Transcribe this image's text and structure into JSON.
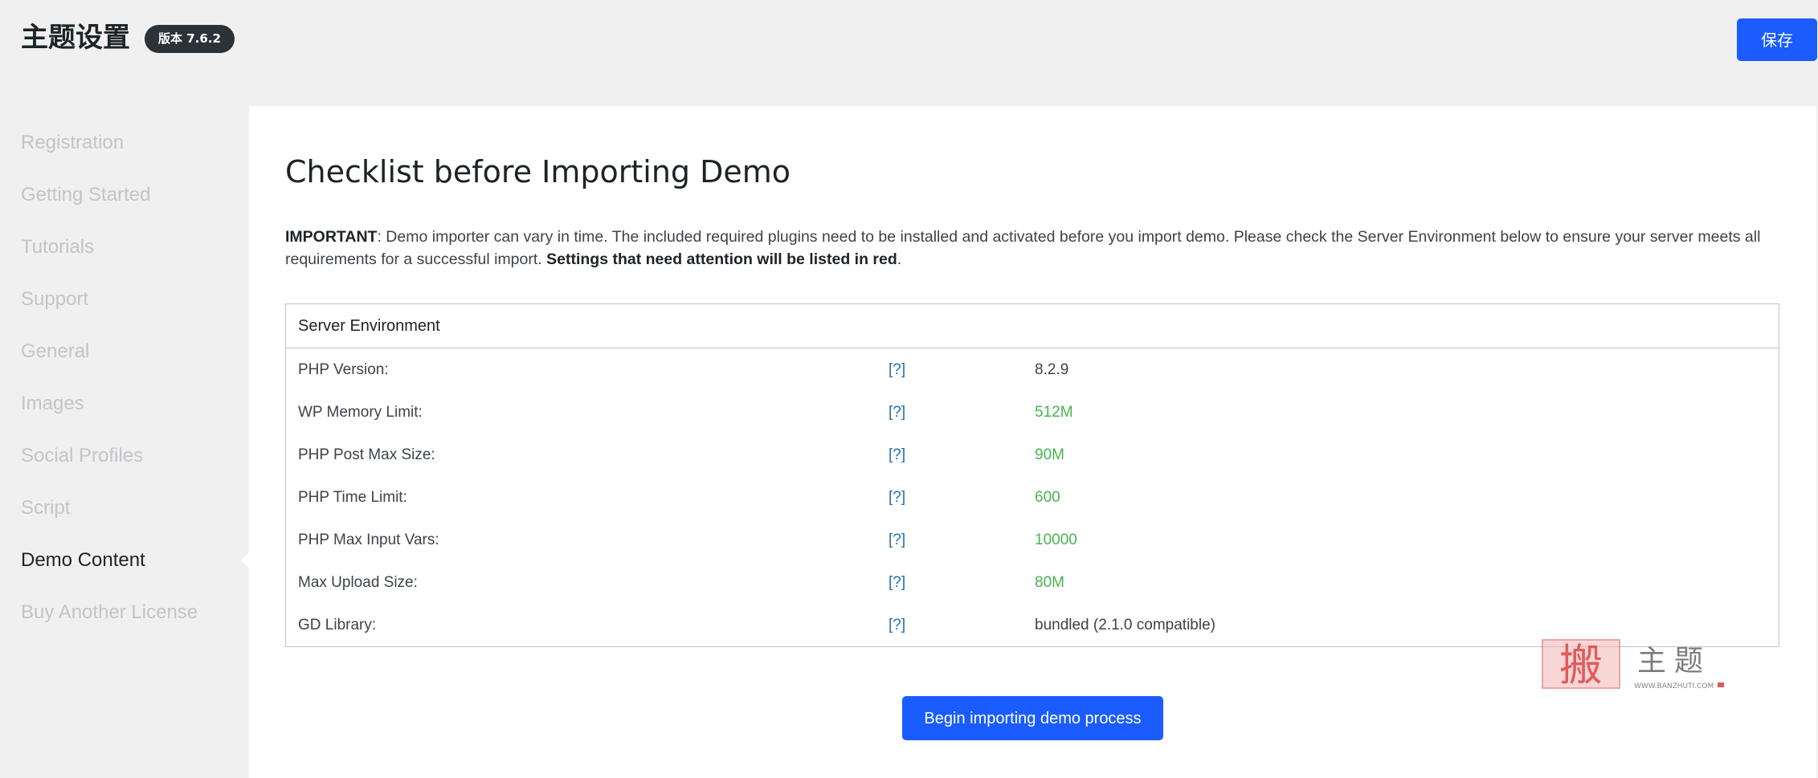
{
  "header": {
    "title": "主题设置",
    "version_badge": "版本 7.6.2",
    "save_label": "保存"
  },
  "sidebar": {
    "items": [
      {
        "label": "Registration"
      },
      {
        "label": "Getting Started"
      },
      {
        "label": "Tutorials"
      },
      {
        "label": "Support"
      },
      {
        "label": "General"
      },
      {
        "label": "Images"
      },
      {
        "label": "Social Profiles"
      },
      {
        "label": "Script"
      },
      {
        "label": "Demo Content"
      },
      {
        "label": "Buy Another License"
      }
    ],
    "active_item": "Demo Content"
  },
  "main": {
    "title": "Checklist before Importing Demo",
    "intro_label": "IMPORTANT",
    "intro_text": ": Demo importer can vary in time. The included required plugins need to be installed and activated before you import demo. Please check the Server Environment below to ensure your server meets all requirements for a successful import. ",
    "intro_emphasis": "Settings that need attention will be listed in red",
    "intro_end": ".",
    "table_header": "Server Environment",
    "help_text": "[?]",
    "rows": [
      {
        "label": "PHP Version:",
        "value": "8.2.9",
        "status": "plain"
      },
      {
        "label": "WP Memory Limit:",
        "value": "512M",
        "status": "ok"
      },
      {
        "label": "PHP Post Max Size:",
        "value": "90M",
        "status": "ok"
      },
      {
        "label": "PHP Time Limit:",
        "value": "600",
        "status": "ok"
      },
      {
        "label": "PHP Max Input Vars:",
        "value": "10000",
        "status": "ok"
      },
      {
        "label": "Max Upload Size:",
        "value": "80M",
        "status": "ok"
      },
      {
        "label": "GD Library:",
        "value": "bundled (2.1.0 compatible)",
        "status": "plain"
      }
    ],
    "import_button_label": "Begin importing demo process"
  },
  "watermark": {
    "stamp_char": "搬",
    "text": "主题",
    "url": "WWW.BANZHUTI.COM"
  },
  "colors": {
    "accent": "#1a5cff",
    "ok": "#46b450",
    "link": "#2271b1",
    "badge_bg": "#2c3338"
  }
}
